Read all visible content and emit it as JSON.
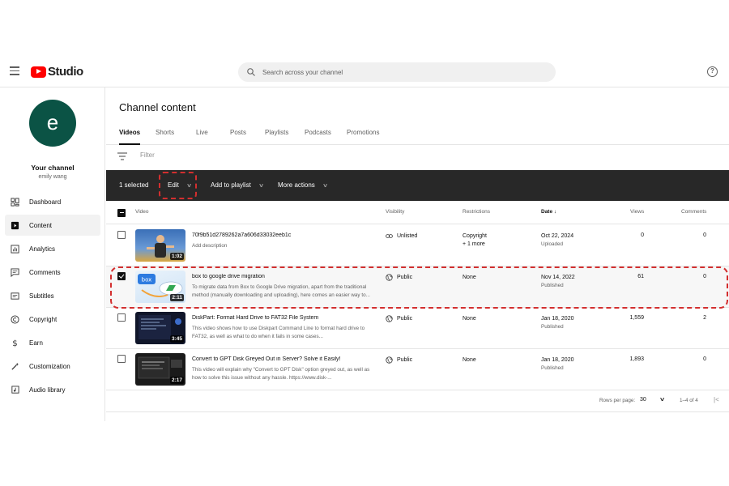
{
  "app": {
    "logo_text": "Studio",
    "search_placeholder": "Search across your channel"
  },
  "channel": {
    "avatar_letter": "e",
    "title": "Your channel",
    "owner": "emily wang"
  },
  "sidebar": {
    "items": [
      {
        "label": "Dashboard",
        "icon": "dashboard-icon",
        "active": false
      },
      {
        "label": "Content",
        "icon": "content-icon",
        "active": true
      },
      {
        "label": "Analytics",
        "icon": "analytics-icon",
        "active": false
      },
      {
        "label": "Comments",
        "icon": "comments-icon",
        "active": false
      },
      {
        "label": "Subtitles",
        "icon": "subtitles-icon",
        "active": false
      },
      {
        "label": "Copyright",
        "icon": "copyright-icon",
        "active": false
      },
      {
        "label": "Earn",
        "icon": "earn-icon",
        "active": false
      },
      {
        "label": "Customization",
        "icon": "customization-icon",
        "active": false
      },
      {
        "label": "Audio library",
        "icon": "audio-library-icon",
        "active": false
      }
    ]
  },
  "main": {
    "title": "Channel content",
    "tabs": [
      {
        "label": "Videos",
        "active": true
      },
      {
        "label": "Shorts",
        "active": false
      },
      {
        "label": "Live",
        "active": false
      },
      {
        "label": "Posts",
        "active": false
      },
      {
        "label": "Playlists",
        "active": false
      },
      {
        "label": "Podcasts",
        "active": false
      },
      {
        "label": "Promotions",
        "active": false
      }
    ],
    "filter_placeholder": "Filter"
  },
  "actionbar": {
    "selected_text": "1 selected",
    "edit_label": "Edit",
    "add_to_playlist_label": "Add to playlist",
    "more_actions_label": "More actions"
  },
  "table": {
    "headers": {
      "video": "Video",
      "visibility": "Visibility",
      "restrictions": "Restrictions",
      "date": "Date",
      "views": "Views",
      "comments": "Comments"
    },
    "rows": [
      {
        "title": "70f9b51d2789262a7a606d33032eeb1c",
        "description": "Add description",
        "duration": "1:02",
        "visibility": "Unlisted",
        "visibility_icon": "link-icon",
        "restrictions": "Copyright",
        "restrictions_extra": "+ 1 more",
        "date": "Oct 22, 2024",
        "date_status": "Uploaded",
        "views": "0",
        "comments": "0",
        "selected": false
      },
      {
        "title": "box to google drive migration",
        "description": "To migrate data from Box to Google Drive migration, apart from the traditional method (manually downloading and uploading), here comes an easier way to...",
        "duration": "2:11",
        "visibility": "Public",
        "visibility_icon": "globe-icon",
        "restrictions": "None",
        "restrictions_extra": "",
        "date": "Nov 14, 2022",
        "date_status": "Published",
        "views": "61",
        "comments": "0",
        "selected": true
      },
      {
        "title": "DiskPart: Format Hard Drive to FAT32 File System",
        "description": "This video shows how to use Diskpart Command Line to format hard drive to FAT32, as well as what to do when it fails in some cases...",
        "duration": "3:45",
        "visibility": "Public",
        "visibility_icon": "globe-icon",
        "restrictions": "None",
        "restrictions_extra": "",
        "date": "Jan 18, 2020",
        "date_status": "Published",
        "views": "1,559",
        "comments": "2",
        "selected": false
      },
      {
        "title": "Convert to GPT Disk Greyed Out in Server? Solve it Easily!",
        "description": "This video will explain why \"Convert to GPT Disk\" option greyed out, as well as how to solve this issue without any hassle. https://www.disk-...",
        "duration": "2:17",
        "visibility": "Public",
        "visibility_icon": "globe-icon",
        "restrictions": "None",
        "restrictions_extra": "",
        "date": "Jan 18, 2020",
        "date_status": "Published",
        "views": "1,893",
        "comments": "0",
        "selected": false
      }
    ]
  },
  "pagination": {
    "rows_per_page_label": "Rows per page:",
    "rows_per_page_value": "30",
    "range": "1–4 of 4"
  },
  "colors": {
    "brand_red": "#ff0000",
    "actionbar_bg": "#282828",
    "avatar_bg": "#0b5345",
    "highlight_dashed": "#d32f2f"
  }
}
